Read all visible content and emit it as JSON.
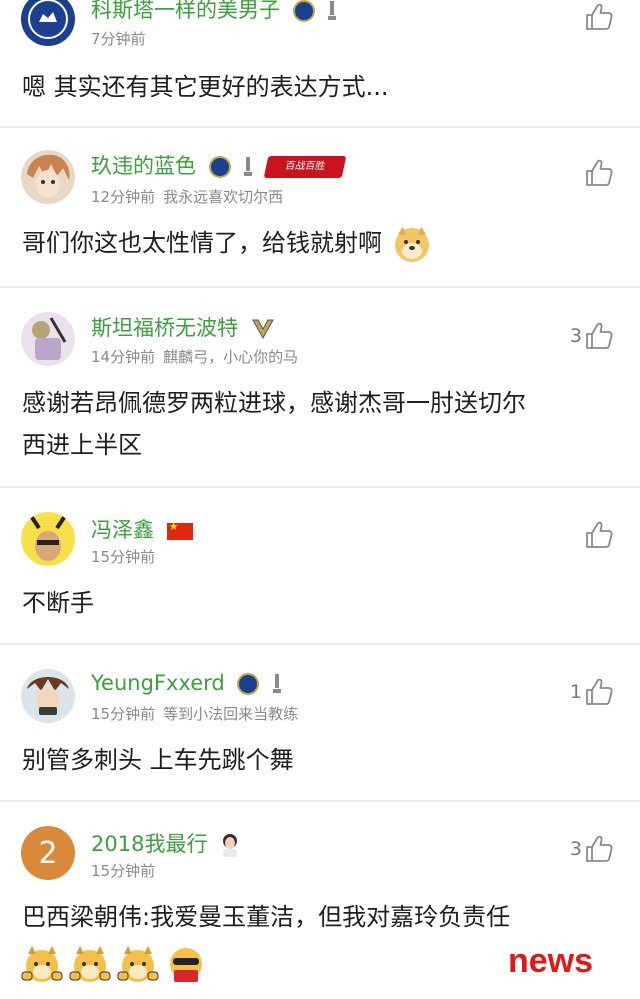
{
  "comments": [
    {
      "username": "科斯塔一样的美男子",
      "time": "7分钟前",
      "signature": "",
      "text": "嗯 其实还有其它更好的表达方式...",
      "likes": ""
    },
    {
      "username": "玖违的蓝色",
      "time": "12分钟前",
      "signature": "我永远喜欢切尔西",
      "text": "哥们你这也太性情了，给钱就射啊",
      "likes": "",
      "banner_text": "百战百胜"
    },
    {
      "username": "斯坦福桥无波特",
      "time": "14分钟前",
      "signature": "麒麟弓，小心你的马",
      "text_lines": [
        "感谢若昂佩德罗两粒进球，感谢杰哥一肘送切尔",
        "西进上半区"
      ],
      "likes": "3"
    },
    {
      "username": "冯泽鑫",
      "time": "15分钟前",
      "signature": "",
      "text": "不断手",
      "likes": ""
    },
    {
      "username": "YeungFxxerd",
      "time": "15分钟前",
      "signature": "等到小法回来当教练",
      "text": "别管多刺头 上车先跳个舞",
      "likes": "1"
    },
    {
      "username": "2018我最行",
      "time": "15分钟前",
      "signature": "",
      "avatar_text": "2",
      "text": "巴西梁朝伟:我爱曼玉董洁，但我对嘉玲负责任",
      "likes": "3"
    }
  ],
  "watermark": "news",
  "colors": {
    "username": "#3ca03c",
    "meta": "#8a8a8a",
    "text": "#1e1e1e",
    "divider": "#ededed",
    "watermark": "#e01818",
    "avatar_2018": "#d9893a"
  },
  "icons": {
    "like": "thumbs-up-outline-icon",
    "club_badge": "chelsea-crest-icon",
    "trophy": "trophy-icon",
    "flag": "china-flag-icon"
  }
}
